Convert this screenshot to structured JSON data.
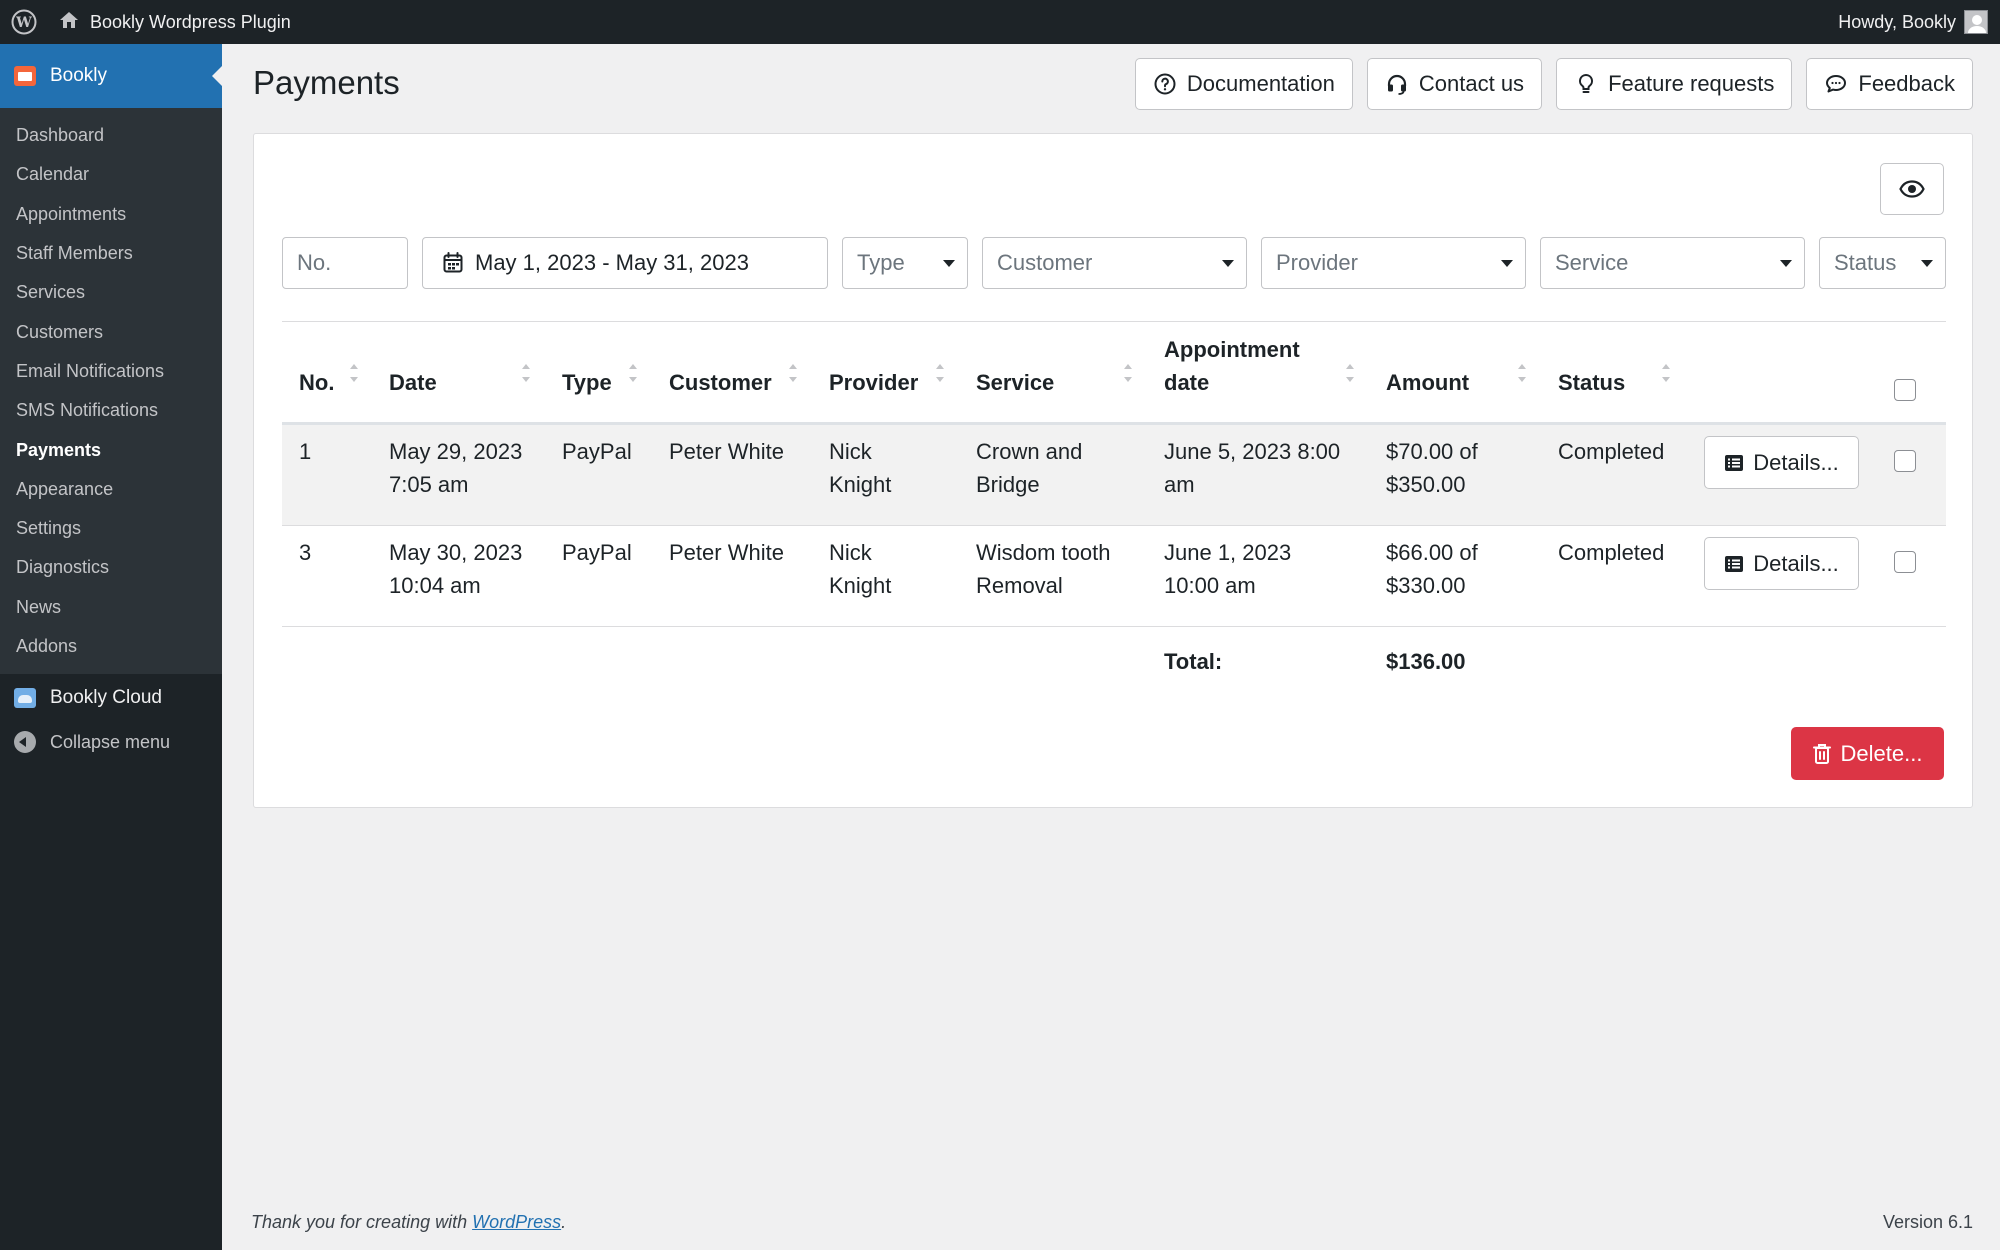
{
  "adminbar": {
    "site_name": "Bookly Wordpress Plugin",
    "howdy": "Howdy, Bookly"
  },
  "sidebar": {
    "top_item": "Bookly",
    "items": [
      {
        "label": "Dashboard"
      },
      {
        "label": "Calendar"
      },
      {
        "label": "Appointments"
      },
      {
        "label": "Staff Members"
      },
      {
        "label": "Services"
      },
      {
        "label": "Customers"
      },
      {
        "label": "Email Notifications"
      },
      {
        "label": "SMS Notifications"
      },
      {
        "label": "Payments",
        "current": true
      },
      {
        "label": "Appearance"
      },
      {
        "label": "Settings"
      },
      {
        "label": "Diagnostics"
      },
      {
        "label": "News"
      },
      {
        "label": "Addons"
      }
    ],
    "cloud": "Bookly Cloud",
    "collapse": "Collapse menu"
  },
  "page": {
    "title": "Payments",
    "buttons": {
      "documentation": "Documentation",
      "contact": "Contact us",
      "features": "Feature requests",
      "feedback": "Feedback"
    }
  },
  "filters": {
    "number_placeholder": "No.",
    "date_range": "May 1, 2023 - May 31, 2023",
    "type": "Type",
    "customer": "Customer",
    "provider": "Provider",
    "service": "Service",
    "status": "Status"
  },
  "table": {
    "headers": {
      "no": "No.",
      "date": "Date",
      "type": "Type",
      "customer": "Customer",
      "provider": "Provider",
      "service": "Service",
      "appt1": "Appointment",
      "appt2": "date",
      "amount": "Amount",
      "status": "Status"
    },
    "rows": [
      {
        "no": "1",
        "date1": "May 29, 2023",
        "date2": "7:05 am",
        "type": "PayPal",
        "customer": "Peter White",
        "provider1": "Nick",
        "provider2": "Knight",
        "service1": "Crown and",
        "service2": "Bridge",
        "appt1": "June 5, 2023 8:00",
        "appt2": "am",
        "amount1": "$70.00 of",
        "amount2": "$350.00",
        "status": "Completed",
        "details": "Details..."
      },
      {
        "no": "3",
        "date1": "May 30, 2023",
        "date2": "10:04 am",
        "type": "PayPal",
        "customer": "Peter White",
        "provider1": "Nick",
        "provider2": "Knight",
        "service1": "Wisdom tooth",
        "service2": "Removal",
        "appt1": "June 1, 2023",
        "appt2": "10:00 am",
        "amount1": "$66.00 of",
        "amount2": "$330.00",
        "status": "Completed",
        "details": "Details..."
      }
    ],
    "total_label": "Total:",
    "total_value": "$136.00"
  },
  "delete_label": "Delete...",
  "footer": {
    "thanks": "Thank you for creating with ",
    "link": "WordPress",
    "period": ".",
    "version": "Version 6.1"
  }
}
